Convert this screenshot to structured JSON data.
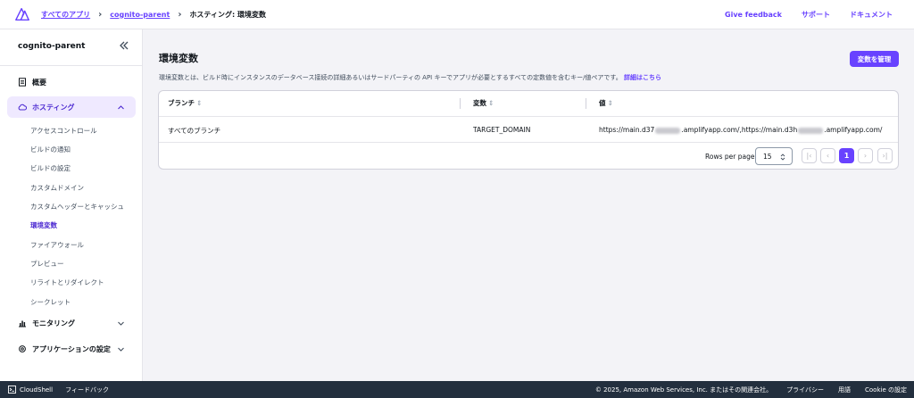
{
  "breadcrumb": {
    "items": [
      "すべてのアプリ",
      "cognito-parent"
    ],
    "current": "ホスティング: 環境変数"
  },
  "header_links": {
    "feedback": "Give feedback",
    "support": "サポート",
    "docs": "ドキュメント"
  },
  "sidebar": {
    "app_name": "cognito-parent",
    "overview": "概要",
    "hosting": "ホスティング",
    "hosting_items": [
      "アクセスコントロール",
      "ビルドの通知",
      "ビルドの設定",
      "カスタムドメイン",
      "カスタムヘッダーとキャッシュ",
      "環境変数",
      "ファイアウォール",
      "プレビュー",
      "リライトとリダイレクト",
      "シークレット"
    ],
    "monitoring": "モニタリング",
    "app_settings": "アプリケーションの設定"
  },
  "main": {
    "title": "環境変数",
    "description": "環境変数とは、ビルド時にインスタンスのデータベース接続の詳細あるいはサードパーティの API キーでアプリが必要とするすべての定数値を含むキー/値ペアです。",
    "learn_more": "詳細はこちら",
    "manage_button": "変数を管理"
  },
  "table": {
    "columns": [
      "ブランチ",
      "変数",
      "値"
    ],
    "rows": [
      {
        "branch": "すべてのブランチ",
        "variable": "TARGET_DOMAIN",
        "value_part1": "https://main.d37",
        "value_part2": ".amplifyapp.com/,https://main.d3h",
        "value_part3": ".amplifyapp.com/"
      }
    ],
    "rows_per_page_label": "Rows per page",
    "rows_per_page_value": "15",
    "current_page": "1"
  },
  "footer": {
    "cloudshell": "CloudShell",
    "feedback": "フィードバック",
    "copyright": "© 2025, Amazon Web Services, Inc. またはその関連会社。",
    "privacy": "プライバシー",
    "terms": "用語",
    "cookie": "Cookie の設定"
  },
  "colors": {
    "accent": "#6842ff",
    "footer_bg": "#232f3e",
    "active_nav_bg": "#efe9ff"
  }
}
